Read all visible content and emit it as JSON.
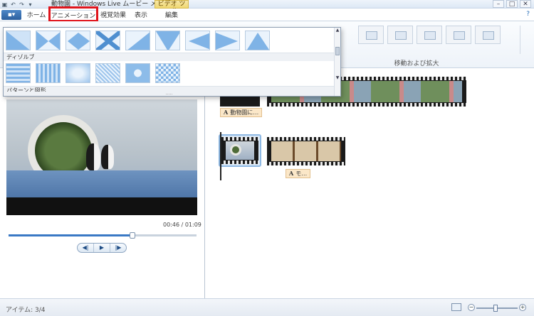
{
  "window": {
    "title": "動物園 - Windows Live ムービー メーカー",
    "tool_tab": "ビデオ ツール",
    "controls": [
      "–",
      "□",
      "✕"
    ]
  },
  "tabs": {
    "file_label": "▪▾",
    "items": [
      {
        "label": "ホーム"
      },
      {
        "label": "アニメーション"
      },
      {
        "label": "視覚効果"
      },
      {
        "label": "表示"
      },
      {
        "label": "編集"
      }
    ],
    "help": "?"
  },
  "ribbon": {
    "group_label": "移動および拡大"
  },
  "gallery": {
    "section_dissolve": "ディゾルブ",
    "section_patterns": "パターンと図形",
    "grip": "....."
  },
  "preview": {
    "time": "00:46 / 01:09",
    "progress": 0.66
  },
  "storyboard": {
    "caption_1": "動物園に…",
    "caption_2": "モ…",
    "caption_icon": "A"
  },
  "status": {
    "items_text": "アイテム: 3/4",
    "zoom_minus": "−",
    "zoom_plus": "+"
  }
}
